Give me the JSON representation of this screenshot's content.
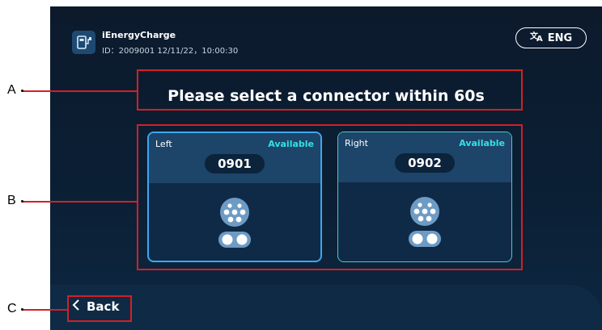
{
  "header": {
    "app_icon": "ev-charger-icon",
    "app_name": "iEnergyCharge",
    "meta": "ID：2009001  12/11/22，10:00:30",
    "language_label": "ENG",
    "language_icon": "translate-icon"
  },
  "prompt": "Please select a connector within 60s",
  "connectors": [
    {
      "side": "Left",
      "status": "Available",
      "code": "0901"
    },
    {
      "side": "Right",
      "status": "Available",
      "code": "0902"
    }
  ],
  "back_label": "Back",
  "callouts": {
    "a": "A",
    "b": "B",
    "c": "C"
  },
  "colors": {
    "accent": "#34e0e6",
    "selected_border": "#3ea7ee",
    "annotation": "#d41f26"
  }
}
